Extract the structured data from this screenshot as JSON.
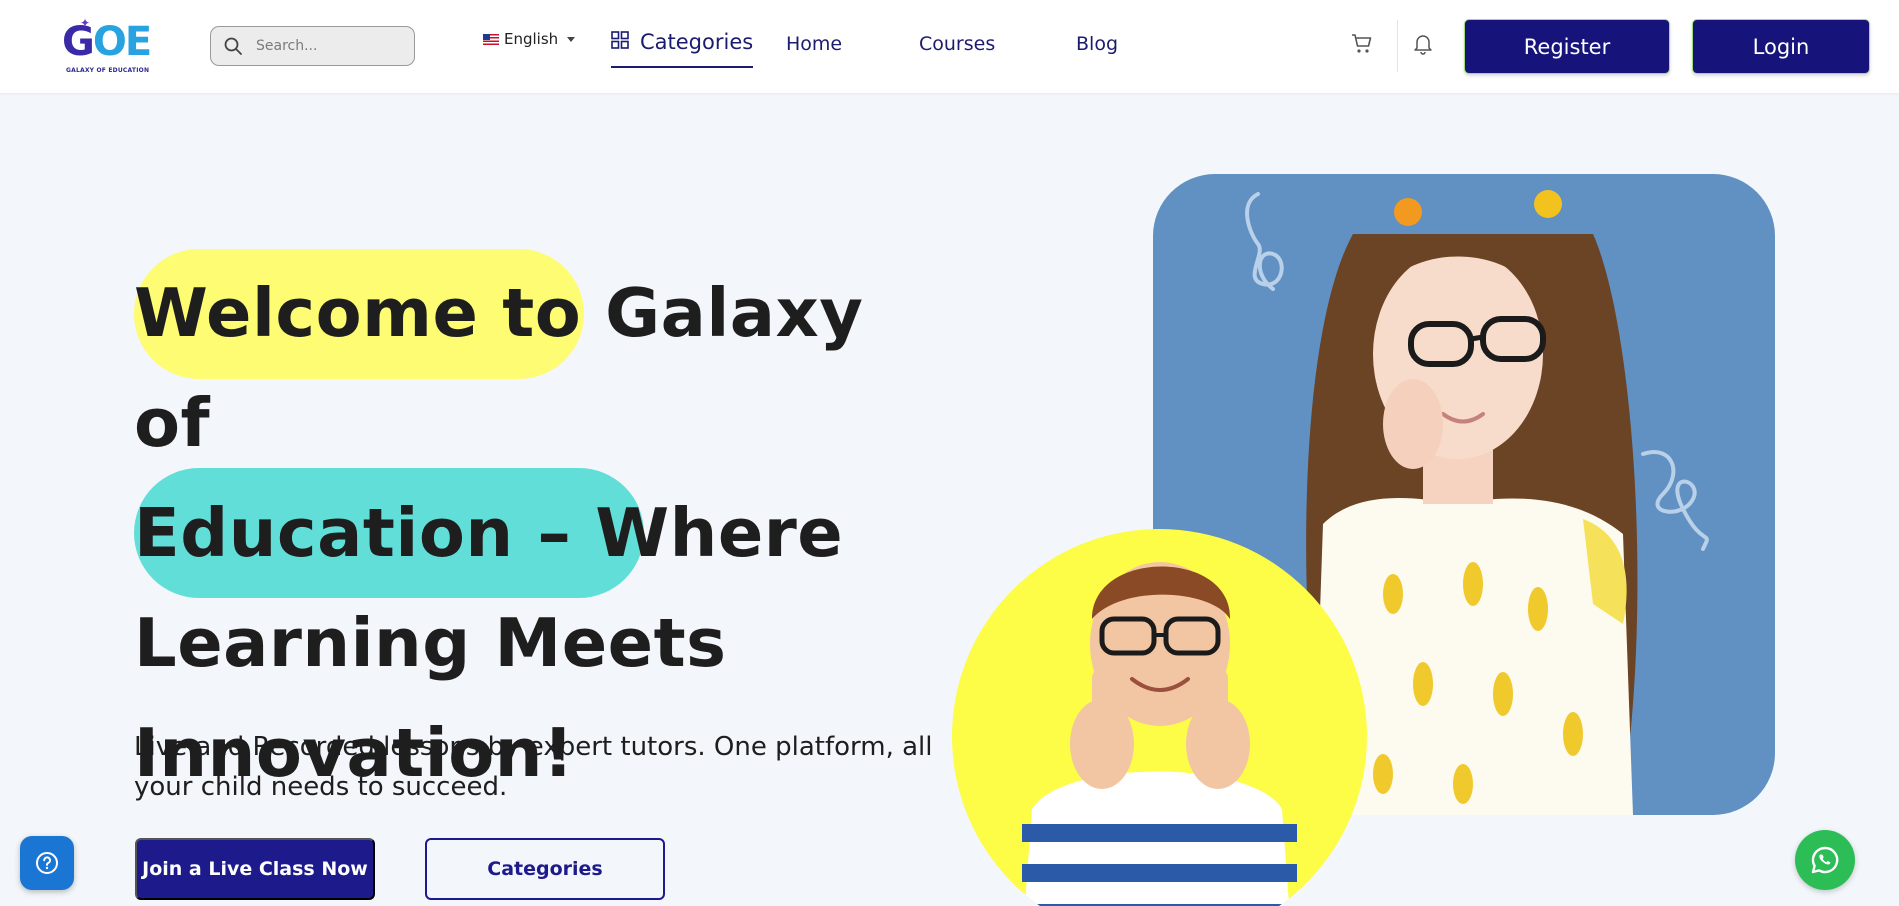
{
  "header": {
    "logo": {
      "mark": "GOE",
      "tagline": "GALAXY OF EDUCATION"
    },
    "search": {
      "placeholder": "Search..."
    },
    "language": {
      "selected": "English",
      "flag_icon": "us-flag-icon"
    },
    "nav": {
      "categories_label": "Categories",
      "links": [
        "Home",
        "Courses",
        "Blog"
      ]
    },
    "register_label": "Register",
    "login_label": "Login"
  },
  "hero": {
    "title_parts": [
      "Welcome to G",
      "alaxy of",
      "Education – Where",
      "Learning Meets",
      "Innovation!"
    ],
    "subtitle": "Live and Recorded lessons by expert tutors. One platform, all your child needs to succeed.",
    "primary_button": "Join a Live Class Now",
    "secondary_button": "Categories"
  },
  "colors": {
    "brand": "#16147a",
    "highlight_yellow": "#fdfc72",
    "highlight_teal": "#62ded9",
    "card_blue": "#6190c3",
    "circle_yellow": "#fdfc46",
    "whatsapp": "#2dbd57",
    "help": "#1b76d3"
  }
}
